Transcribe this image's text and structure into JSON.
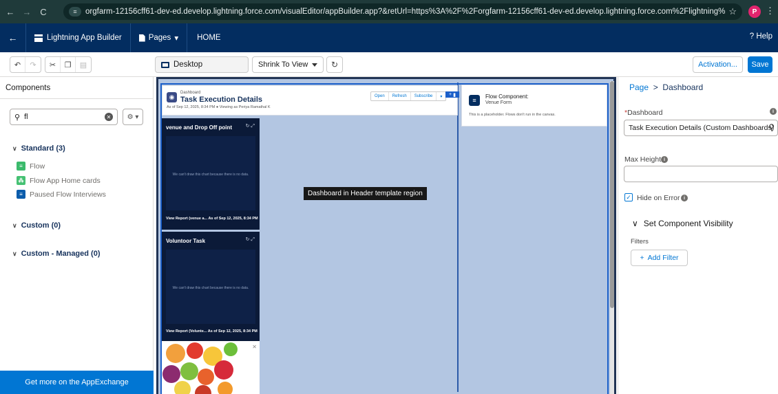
{
  "browser": {
    "url": "orgfarm-12156cff61-dev-ed.develop.lightning.force.com/visualEditor/appBuilder.app?&retUrl=https%3A%2F%2Forgfarm-12156cff61-dev-ed.develop.lightning.force.com%2Flightning%2Fsetup%2FFlexi...",
    "profile_initial": "P"
  },
  "header": {
    "app_name": "Lightning App Builder",
    "pages_label": "Pages",
    "page_name": "HOME",
    "help_label": "Help"
  },
  "toolbar": {
    "device": "Desktop",
    "zoom": "Shrink To View",
    "activation_label": "Activation...",
    "save_label": "Save"
  },
  "components_panel": {
    "title": "Components",
    "search_value": "fl",
    "sections": [
      {
        "label": "Standard (3)",
        "items": [
          "Flow",
          "Flow App Home cards",
          "Paused Flow Interviews"
        ]
      },
      {
        "label": "Custom (0)"
      },
      {
        "label": "Custom - Managed (0)"
      }
    ],
    "appexchange_label": "Get more on the AppExchange"
  },
  "canvas": {
    "dashboard": {
      "label": "Dashboard",
      "title": "Task Execution Details",
      "meta": "As of Sep 12, 2025, 8:34 PM ● Viewing as Periya Ramathal K",
      "buttons": [
        "Open",
        "Refresh",
        "Subscribe"
      ]
    },
    "cards": [
      {
        "title": "venue and Drop Off point",
        "no_data": "We can't draw this chart because there is no data.",
        "footer_link": "View Report (venue a...",
        "footer_time": "As of Sep 12, 2025, 8:34 PM"
      },
      {
        "title": "Voluntoor Task",
        "no_data": "We can't draw this chart because there is no data.",
        "footer_link": "View Report (Volunte...",
        "footer_time": "As of Sep 12, 2025, 8:34 PM"
      }
    ],
    "tooltip": "Dashboard in Header template region",
    "flow": {
      "title": "Flow Component:",
      "name": "Venue Form",
      "note": "This is a placeholder. Flows don't run in the canvas."
    }
  },
  "properties": {
    "breadcrumb_root": "Page",
    "breadcrumb_current": "Dashboard",
    "dashboard_label": "Dashboard",
    "dashboard_value": "Task Execution Details (Custom Dashboards)",
    "max_height_label": "Max Height",
    "max_height_value": "",
    "hide_on_error_label": "Hide on Error",
    "hide_on_error": true,
    "visibility_label": "Set Component Visibility",
    "filters_label": "Filters",
    "add_filter_label": "Add Filter"
  },
  "colors": {
    "header": "#032d60",
    "accent": "#0176d3",
    "canvas_region": "#b3c6e2",
    "card_bg": "#0b1a38"
  }
}
